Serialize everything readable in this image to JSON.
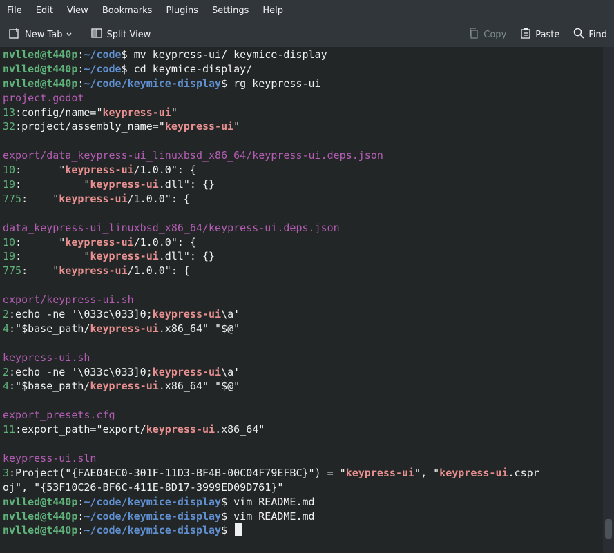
{
  "menu": [
    "File",
    "Edit",
    "View",
    "Bookmarks",
    "Plugins",
    "Settings",
    "Help"
  ],
  "toolbar": {
    "new_tab": "New Tab",
    "split_view": "Split View",
    "copy": "Copy",
    "paste": "Paste",
    "find": "Find"
  },
  "terminal": {
    "lines": [
      [
        [
          "u",
          "nvlled@t440p"
        ],
        [
          "t",
          ":"
        ],
        [
          "p",
          "~/code"
        ],
        [
          "t",
          "$ mv keypress-ui/ keymice-display"
        ]
      ],
      [
        [
          "u",
          "nvlled@t440p"
        ],
        [
          "t",
          ":"
        ],
        [
          "p",
          "~/code"
        ],
        [
          "t",
          "$ cd keymice-display/"
        ]
      ],
      [
        [
          "u",
          "nvlled@t440p"
        ],
        [
          "t",
          ":"
        ],
        [
          "p",
          "~/code/keymice-display"
        ],
        [
          "t",
          "$ rg keypress-ui"
        ]
      ],
      [
        [
          "f",
          "project.godot"
        ]
      ],
      [
        [
          "n",
          "13"
        ],
        [
          "t",
          ":config/name=\""
        ],
        [
          "m",
          "keypress-ui"
        ],
        [
          "t",
          "\""
        ]
      ],
      [
        [
          "n",
          "32"
        ],
        [
          "t",
          ":project/assembly_name=\""
        ],
        [
          "m",
          "keypress-ui"
        ],
        [
          "t",
          "\""
        ]
      ],
      [],
      [
        [
          "f",
          "export/data_keypress-ui_linuxbsd_x86_64/keypress-ui.deps.json"
        ]
      ],
      [
        [
          "n",
          "10"
        ],
        [
          "t",
          ":      \""
        ],
        [
          "m",
          "keypress-ui"
        ],
        [
          "t",
          "/1.0.0\": {"
        ]
      ],
      [
        [
          "n",
          "19"
        ],
        [
          "t",
          ":          \""
        ],
        [
          "m",
          "keypress-ui"
        ],
        [
          "t",
          ".dll\": {}"
        ]
      ],
      [
        [
          "n",
          "775"
        ],
        [
          "t",
          ":    \""
        ],
        [
          "m",
          "keypress-ui"
        ],
        [
          "t",
          "/1.0.0\": {"
        ]
      ],
      [],
      [
        [
          "f",
          "data_keypress-ui_linuxbsd_x86_64/keypress-ui.deps.json"
        ]
      ],
      [
        [
          "n",
          "10"
        ],
        [
          "t",
          ":      \""
        ],
        [
          "m",
          "keypress-ui"
        ],
        [
          "t",
          "/1.0.0\": {"
        ]
      ],
      [
        [
          "n",
          "19"
        ],
        [
          "t",
          ":          \""
        ],
        [
          "m",
          "keypress-ui"
        ],
        [
          "t",
          ".dll\": {}"
        ]
      ],
      [
        [
          "n",
          "775"
        ],
        [
          "t",
          ":    \""
        ],
        [
          "m",
          "keypress-ui"
        ],
        [
          "t",
          "/1.0.0\": {"
        ]
      ],
      [],
      [
        [
          "f",
          "export/keypress-ui.sh"
        ]
      ],
      [
        [
          "n",
          "2"
        ],
        [
          "t",
          ":echo -ne '\\033c\\033]0;"
        ],
        [
          "m",
          "keypress-ui"
        ],
        [
          "t",
          "\\a'"
        ]
      ],
      [
        [
          "n",
          "4"
        ],
        [
          "t",
          ":\"$base_path/"
        ],
        [
          "m",
          "keypress-ui"
        ],
        [
          "t",
          ".x86_64\" \"$@\""
        ]
      ],
      [],
      [
        [
          "f",
          "keypress-ui.sh"
        ]
      ],
      [
        [
          "n",
          "2"
        ],
        [
          "t",
          ":echo -ne '\\033c\\033]0;"
        ],
        [
          "m",
          "keypress-ui"
        ],
        [
          "t",
          "\\a'"
        ]
      ],
      [
        [
          "n",
          "4"
        ],
        [
          "t",
          ":\"$base_path/"
        ],
        [
          "m",
          "keypress-ui"
        ],
        [
          "t",
          ".x86_64\" \"$@\""
        ]
      ],
      [],
      [
        [
          "f",
          "export_presets.cfg"
        ]
      ],
      [
        [
          "n",
          "11"
        ],
        [
          "t",
          ":export_path=\"export/"
        ],
        [
          "m",
          "keypress-ui"
        ],
        [
          "t",
          ".x86_64\""
        ]
      ],
      [],
      [
        [
          "f",
          "keypress-ui.sln"
        ]
      ],
      [
        [
          "n",
          "3"
        ],
        [
          "t",
          ":Project(\"{FAE04EC0-301F-11D3-BF4B-00C04F79EFBC}\") = \""
        ],
        [
          "m",
          "keypress-ui"
        ],
        [
          "t",
          "\", \""
        ],
        [
          "m",
          "keypress-ui"
        ],
        [
          "t",
          ".cspr"
        ]
      ],
      [
        [
          "t",
          "oj\", \"{53F10C26-BF6C-411E-8D17-3999ED09D761}\""
        ]
      ],
      [
        [
          "u",
          "nvlled@t440p"
        ],
        [
          "t",
          ":"
        ],
        [
          "p",
          "~/code/keymice-display"
        ],
        [
          "t",
          "$ vim README.md"
        ]
      ],
      [
        [
          "u",
          "nvlled@t440p"
        ],
        [
          "t",
          ":"
        ],
        [
          "p",
          "~/code/keymice-display"
        ],
        [
          "t",
          "$ vim README.md"
        ]
      ],
      [
        [
          "u",
          "nvlled@t440p"
        ],
        [
          "t",
          ":"
        ],
        [
          "p",
          "~/code/keymice-display"
        ],
        [
          "t",
          "$ "
        ]
      ]
    ]
  }
}
